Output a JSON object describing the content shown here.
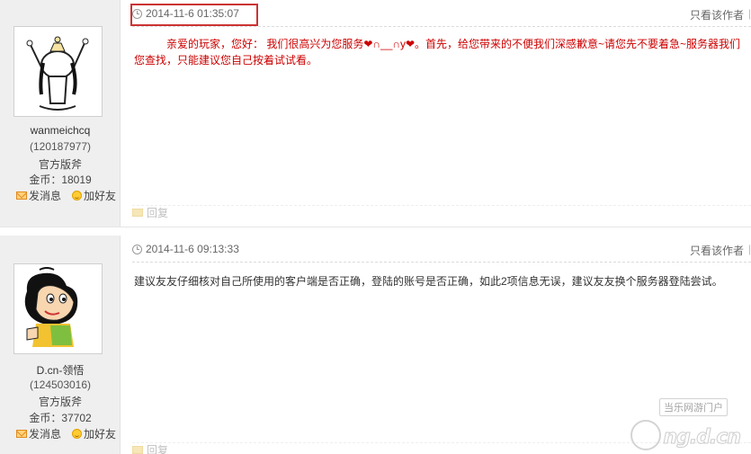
{
  "posts": [
    {
      "user": {
        "name": "wanmeichcq",
        "id": "(120187977)",
        "rank": "官方版斧",
        "gold": "金币：18019",
        "send_message": "发消息",
        "add_friend": "加好友"
      },
      "time": "2014-11-6 01:35:07",
      "only_author": "只看该作者",
      "only_author_sep": "|",
      "body_line1": "亲爱的玩家，您好：     我们很高兴为您服务❤∩__∩y❤。首先，给您带来的不便我们深感歉意~请您先不要着急~服务器我们",
      "body_line2": "您查找，只能建议您自己按着试试看。",
      "body_color": "#cc0000",
      "reply": "回复"
    },
    {
      "user": {
        "name": "D.cn-领悟",
        "id": "(124503016)",
        "rank": "官方版斧",
        "gold": "金币：37702",
        "send_message": "发消息",
        "add_friend": "加好友"
      },
      "time": "2014-11-6 09:13:33",
      "only_author": "只看该作者",
      "only_author_sep": "|",
      "body": "建议友友仔细核对自己所使用的客户端是否正确，登陆的账号是否正确，如此2项信息无误，建议友友换个服务器登陆尝试。",
      "reply": "回复"
    }
  ],
  "highlight_color": "#cc3333",
  "watermark": {
    "tagline": "当乐网游门户",
    "brand": "ng.d.cn"
  }
}
